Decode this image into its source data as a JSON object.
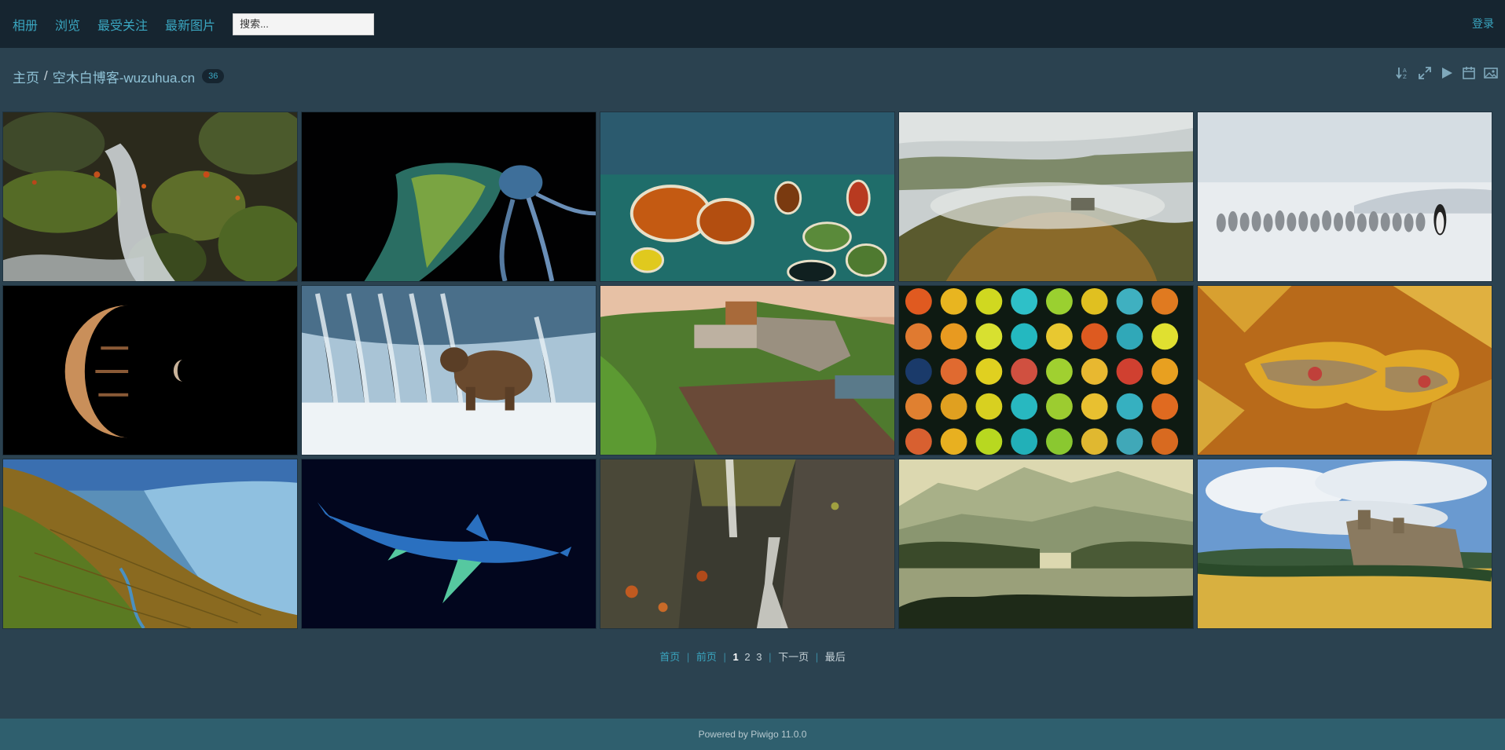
{
  "nav": {
    "items": [
      "相册",
      "浏览",
      "最受关注",
      "最新图片"
    ],
    "search_placeholder": "搜索...",
    "login_label": "登录"
  },
  "breadcrumb": {
    "home": "主页",
    "separator": "/",
    "current": "空木白博客-wuzuhua.cn",
    "count": "36"
  },
  "toolbar": {
    "icons": [
      "sort-az-icon",
      "expand-icon",
      "slideshow-play-icon",
      "calendar-icon",
      "image-icon"
    ]
  },
  "photos": [
    {
      "subject": "mossy-rocks-stream"
    },
    {
      "subject": "octopus"
    },
    {
      "subject": "colorful-salt-ponds"
    },
    {
      "subject": "misty-castle-hill"
    },
    {
      "subject": "penguins-snow"
    },
    {
      "subject": "jupiter-moon"
    },
    {
      "subject": "bear-waterfall"
    },
    {
      "subject": "cliff-village"
    },
    {
      "subject": "lanterns"
    },
    {
      "subject": "moth-leaves"
    },
    {
      "subject": "vineyard-lake"
    },
    {
      "subject": "shark"
    },
    {
      "subject": "canyon-waterfall"
    },
    {
      "subject": "misty-lake-mountains"
    },
    {
      "subject": "castle-meadow"
    }
  ],
  "pagination": {
    "first": "首页",
    "prev": "前页",
    "current": "1",
    "pages": [
      "2",
      "3"
    ],
    "next": "下一页",
    "last": "最后"
  },
  "footer": {
    "text": "Powered by Piwigo 11.0.0"
  },
  "colors": {
    "background": "#2b4250",
    "navbar": "#162530",
    "link": "#3aa6c0",
    "footer": "#2f5f6e"
  }
}
